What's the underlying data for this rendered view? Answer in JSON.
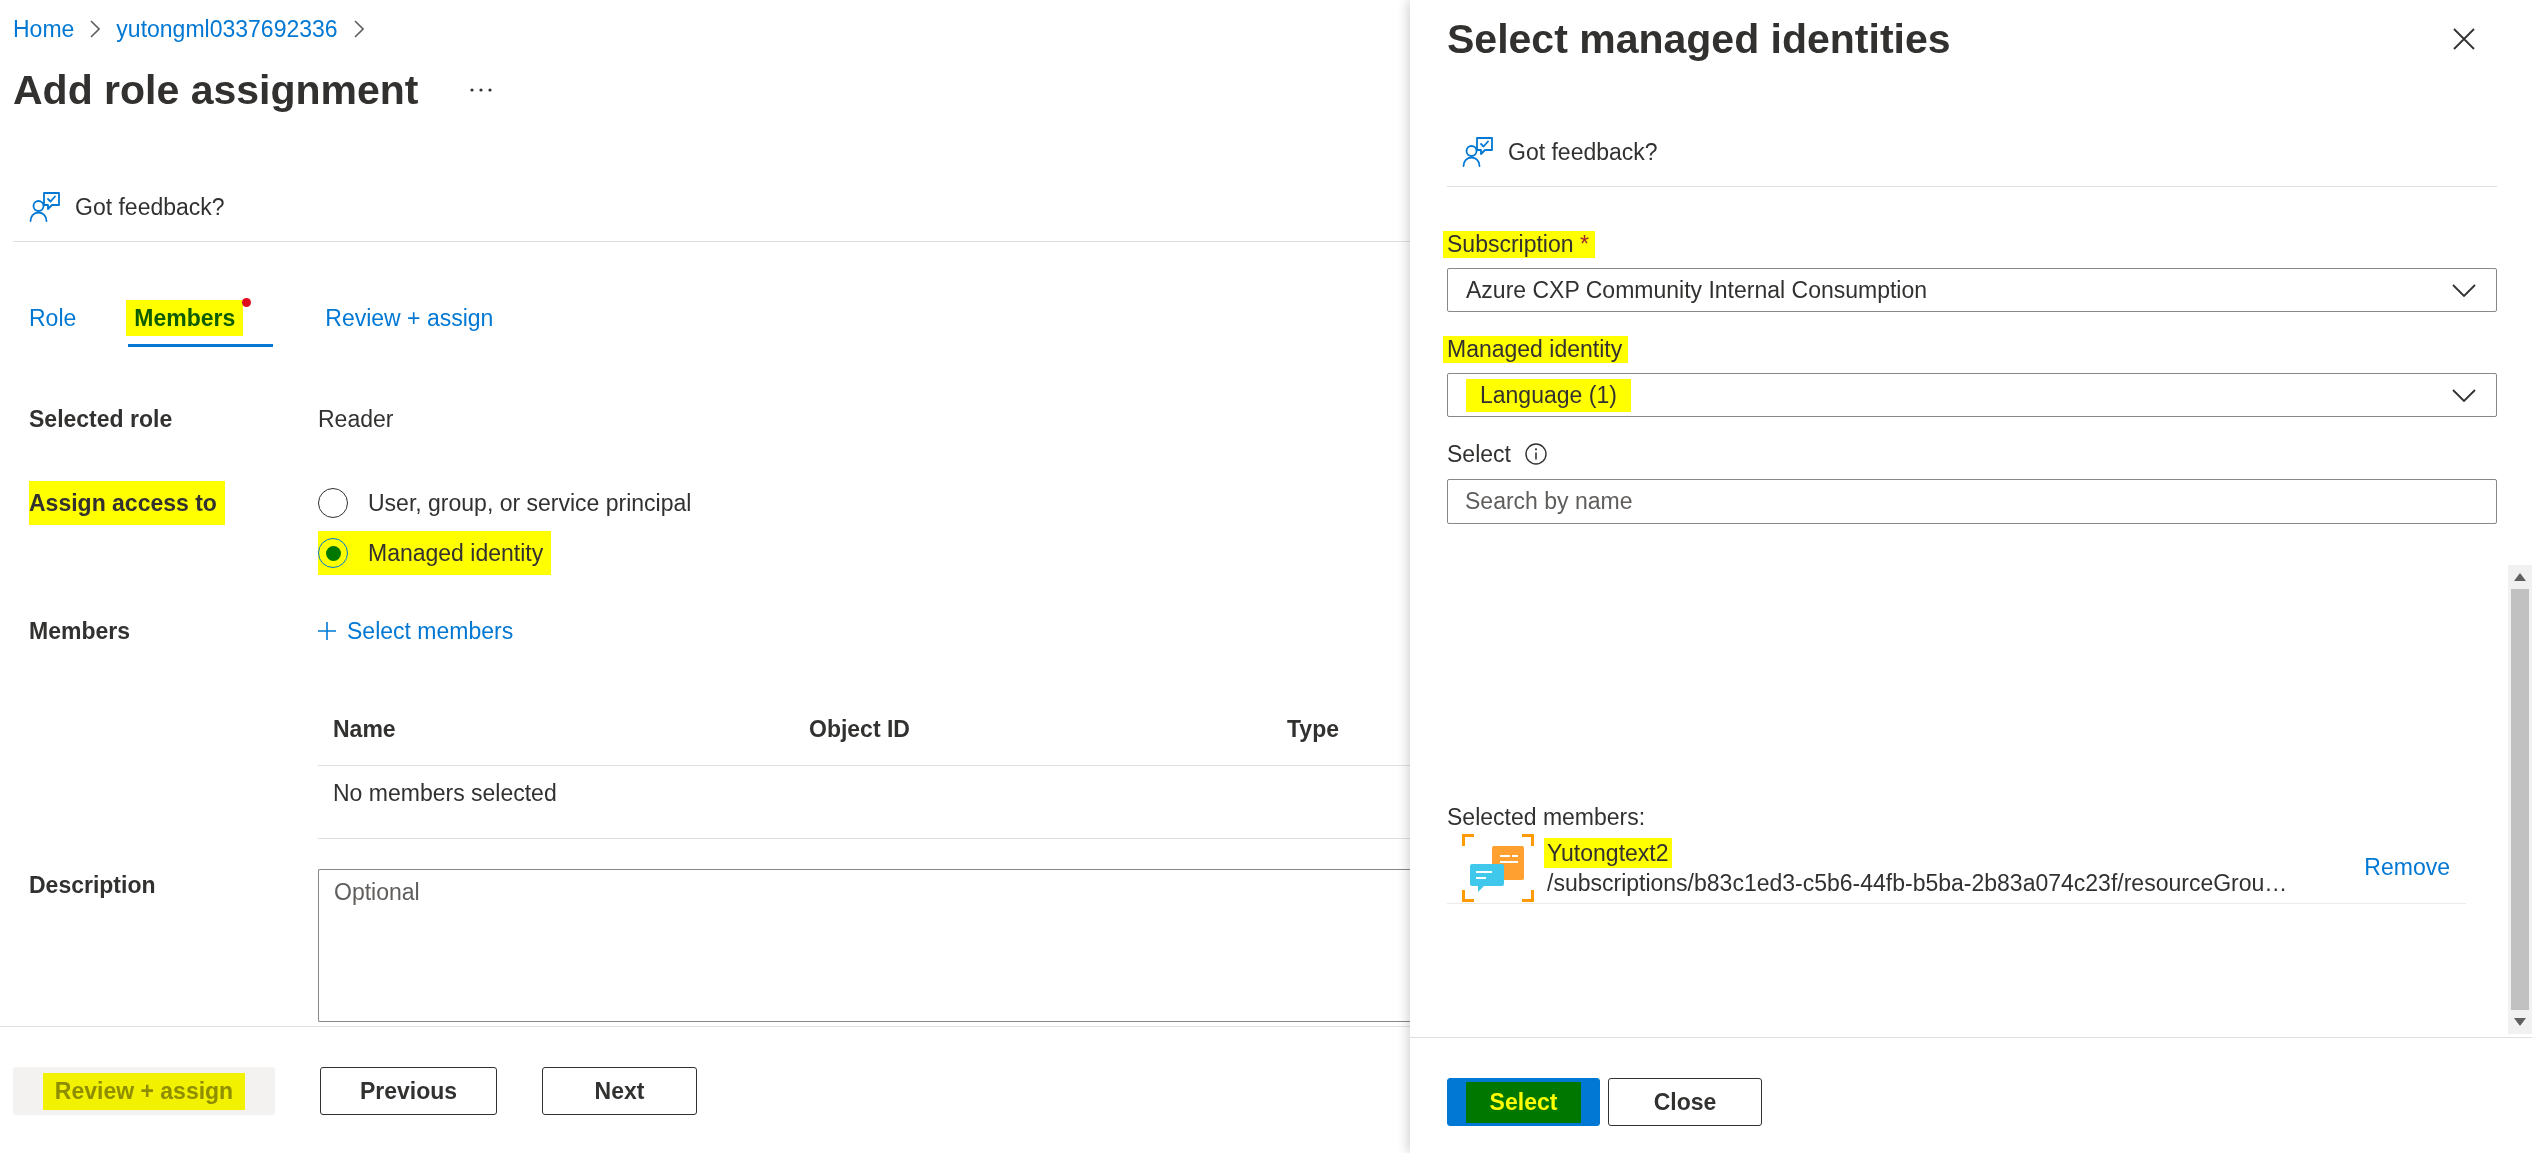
{
  "breadcrumb": [
    {
      "label": "Home"
    },
    {
      "label": "yutongml0337692336"
    }
  ],
  "header": {
    "title": "Add role assignment"
  },
  "feedback": {
    "label": "Got feedback?"
  },
  "tabs": [
    {
      "label": "Role",
      "selected": false,
      "alert": false,
      "highlighted": false
    },
    {
      "label": "Members",
      "selected": true,
      "alert": true,
      "highlighted": true
    },
    {
      "label": "Review + assign",
      "selected": false,
      "alert": false,
      "highlighted": false
    }
  ],
  "form": {
    "selected_role": {
      "label": "Selected role",
      "value": "Reader"
    },
    "assign_access": {
      "label": "Assign access to",
      "highlighted": true,
      "options": [
        {
          "label": "User, group, or service principal",
          "selected": false,
          "highlighted": false
        },
        {
          "label": "Managed identity",
          "selected": true,
          "highlighted": true
        }
      ]
    },
    "members": {
      "label": "Members",
      "action": "Select members",
      "table": {
        "columns": [
          "Name",
          "Object ID",
          "Type"
        ],
        "empty_text": "No members selected"
      }
    },
    "description": {
      "label": "Description",
      "placeholder": "Optional"
    }
  },
  "footer": {
    "buttons": [
      {
        "label": "Review + assign",
        "kind": "primary",
        "disabled": true,
        "highlighted": true
      },
      {
        "label": "Previous",
        "kind": "secondary",
        "disabled": false,
        "highlighted": false
      },
      {
        "label": "Next",
        "kind": "secondary",
        "disabled": false,
        "highlighted": false
      }
    ]
  },
  "panel": {
    "title": "Select managed identities",
    "feedback": {
      "label": "Got feedback?"
    },
    "fields": [
      {
        "kind": "dropdown",
        "label": "Subscription",
        "required_mark": "*",
        "label_highlighted": true,
        "value": "Azure CXP Community Internal Consumption",
        "value_highlighted": false
      },
      {
        "kind": "dropdown",
        "label": "Managed identity",
        "label_highlighted": true,
        "value": "Language (1)",
        "value_highlighted": true
      },
      {
        "kind": "search",
        "label": "Select",
        "label_highlighted": false,
        "info": true,
        "placeholder": "Search by name"
      }
    ],
    "selected_members": {
      "label": "Selected members:",
      "items": [
        {
          "name": "Yutongtext2",
          "path": "/subscriptions/b83c1ed3-c5b6-44fb-b5ba-2b83a074c23f/resourceGrou…",
          "action": "Remove",
          "highlighted": true
        }
      ]
    },
    "buttons": [
      {
        "label": "Select",
        "kind": "primary",
        "disabled": false,
        "highlighted": true
      },
      {
        "label": "Close",
        "kind": "secondary",
        "disabled": false,
        "highlighted": false
      }
    ]
  }
}
